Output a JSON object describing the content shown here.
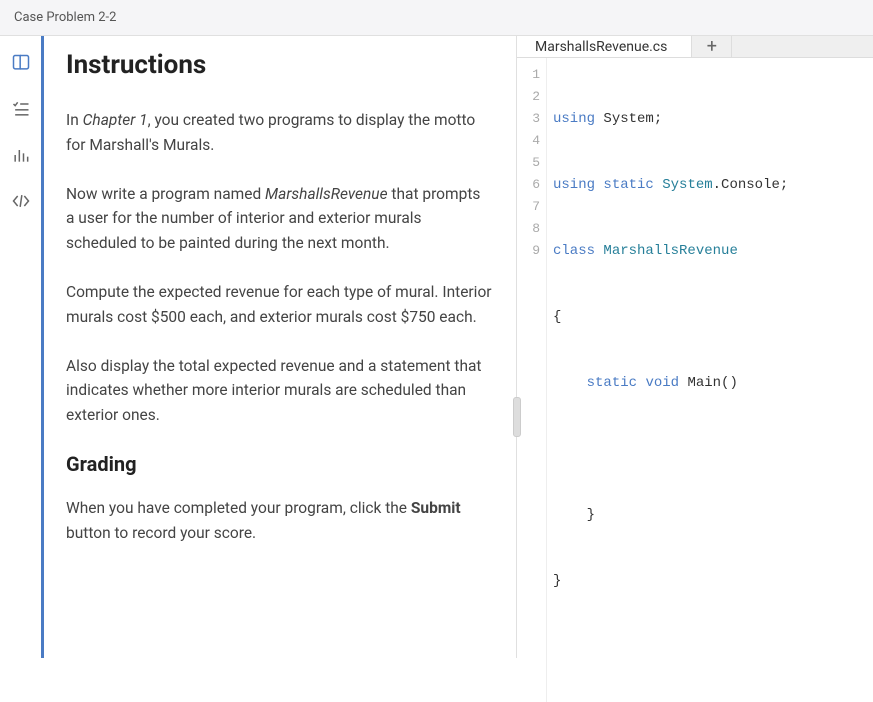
{
  "header": {
    "title": "Case Problem 2-2"
  },
  "sidebar": {
    "items": [
      {
        "name": "book-icon"
      },
      {
        "name": "checklist-icon"
      },
      {
        "name": "chart-icon"
      },
      {
        "name": "code-icon"
      }
    ]
  },
  "instructions": {
    "title": "Instructions",
    "p1_prefix": "In ",
    "p1_chapter": "Chapter 1",
    "p1_suffix": ", you created two programs to display the motto for Marshall's Murals.",
    "p2_prefix": "Now write a program named ",
    "p2_name": "MarshallsRevenue",
    "p2_suffix": " that prompts a user for the number of interior and exterior murals scheduled to be painted during the next month.",
    "p3": "Compute the expected revenue for each type of mural. Interior murals cost $500 each, and exterior murals cost $750 each.",
    "p4": "Also display the total expected revenue and a statement that indicates whether more interior murals are scheduled than exterior ones.",
    "grading_title": "Grading",
    "p5_prefix": "When you have completed your program, click the ",
    "p5_submit": "Submit",
    "p5_suffix": " button to record your score."
  },
  "editor": {
    "tab_label": "MarshallsRevenue.cs",
    "tab_add": "+",
    "gutter": [
      "1",
      "2",
      "3",
      "4",
      "5",
      "6",
      "7",
      "8",
      "9"
    ],
    "line1": {
      "k1": "using",
      "rest": " System;"
    },
    "line2": {
      "k1": "using",
      "k2": "static",
      "t1": " System",
      "rest": ".Console;"
    },
    "line3": {
      "k1": "class",
      "t1": " MarshallsRevenue"
    },
    "line4": {
      "txt": "{"
    },
    "line5": {
      "indent": "    ",
      "k1": "static",
      "k2": "void",
      "rest": " Main()"
    },
    "line6": {
      "txt": ""
    },
    "line7": {
      "txt": "    }"
    },
    "line8": {
      "txt": "}"
    },
    "line9": {
      "txt": ""
    }
  }
}
